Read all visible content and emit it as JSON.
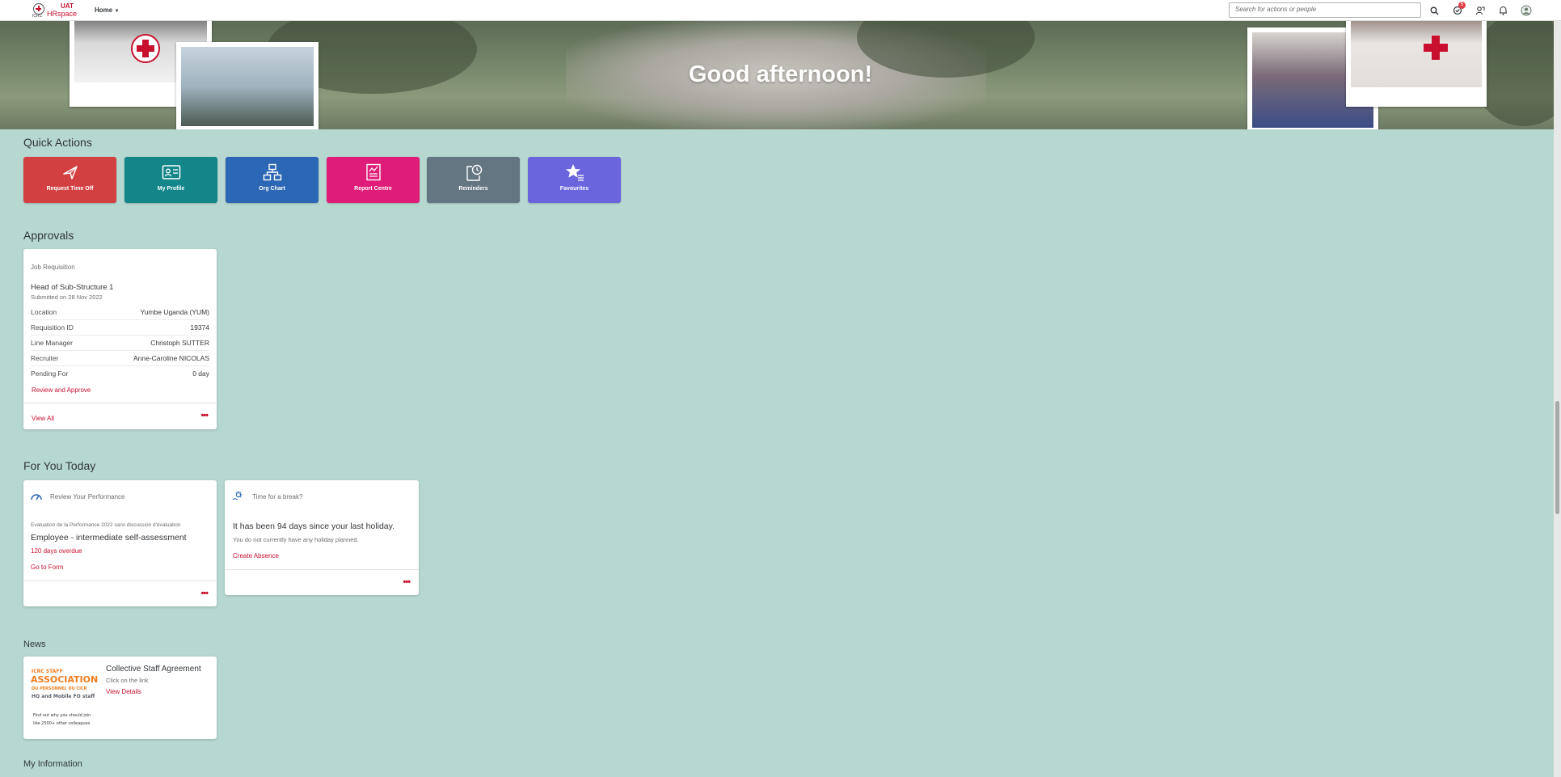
{
  "header": {
    "logo_org": "ICRC",
    "logo_env": "UAT",
    "logo_app": "HRspace",
    "nav_home": "Home",
    "search_placeholder": "Search for actions or people",
    "notification_badge": "5"
  },
  "hero": {
    "greeting": "Good afternoon!"
  },
  "quick_actions": {
    "title": "Quick Actions",
    "tiles": [
      {
        "label": "Request Time Off",
        "icon": "airplane-icon",
        "color": "#d24041"
      },
      {
        "label": "My Profile",
        "icon": "id-card-icon",
        "color": "#138689"
      },
      {
        "label": "Org Chart",
        "icon": "org-chart-icon",
        "color": "#2b67b5"
      },
      {
        "label": "Report Centre",
        "icon": "report-icon",
        "color": "#e01c79"
      },
      {
        "label": "Reminders",
        "icon": "clock-note-icon",
        "color": "#657683"
      },
      {
        "label": "Favourites",
        "icon": "star-list-icon",
        "color": "#6a65dd"
      }
    ]
  },
  "approvals": {
    "title": "Approvals",
    "card": {
      "type": "Job Requisition",
      "position": "Head of Sub-Structure 1",
      "submitted": "Submitted on 28 Nov 2022",
      "rows": [
        {
          "label": "Location",
          "value": "Yumbe Uganda (YUM)"
        },
        {
          "label": "Requisition ID",
          "value": "19374"
        },
        {
          "label": "Line Manager",
          "value": "Christoph SUTTER"
        },
        {
          "label": "Recruiter",
          "value": "Anne-Caroline NICOLAS"
        },
        {
          "label": "Pending For",
          "value": "0 day"
        }
      ],
      "action": "Review and Approve",
      "view_all": "View All"
    }
  },
  "for_you_today": {
    "title": "For You Today",
    "performance": {
      "heading": "Review Your Performance",
      "form_name": "Evaluation de la Performance 2022 sans discussion d'évaluation",
      "step": "Employee - intermediate self-assessment",
      "overdue": "120 days overdue",
      "action": "Go to Form"
    },
    "break": {
      "heading": "Time for a break?",
      "message": "It has been 94 days since your last holiday.",
      "sub": "You do not currently have any holiday planned.",
      "action": "Create Absence"
    }
  },
  "news": {
    "title": "News",
    "item": {
      "image_text": [
        "ICRC STAFF",
        "ASSOCIATION",
        "DU PERSONNEL DU CICR",
        "HQ and Mobile FO staff",
        "Find out why you should join",
        "like 2500+ other colleagues"
      ],
      "headline": "Collective Staff Agreement",
      "sub": "Click on the link",
      "action": "View Details"
    }
  },
  "my_information": {
    "title": "My Information"
  }
}
